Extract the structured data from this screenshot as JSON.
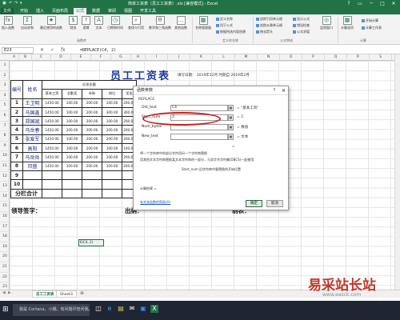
{
  "window": {
    "title": "简单工资表（员工工资表）.xls [兼容模式] - Excel",
    "quick_access": [
      "▣",
      "↶",
      "↷",
      "▾"
    ],
    "controls": [
      "?",
      "▭",
      "─",
      "□",
      "✕"
    ]
  },
  "tabs": [
    "文件",
    "开始",
    "插入",
    "页面布局",
    "公式",
    "数据",
    "审阅",
    "视图",
    "开发工具"
  ],
  "active_tab": "公式",
  "ribbon": {
    "big_buttons": [
      {
        "icon": "fx",
        "label": "插入函数"
      },
      {
        "icon": "Σ",
        "label": "自动求和"
      },
      {
        "icon": "★",
        "label": "最近使用的函数"
      },
      {
        "icon": "$",
        "label": "财务"
      },
      {
        "icon": "?",
        "label": "逻辑"
      },
      {
        "icon": "A",
        "label": "文本"
      },
      {
        "icon": "◷",
        "label": "日期和时间"
      },
      {
        "icon": "⌕",
        "label": "查找与引用"
      },
      {
        "icon": "θ",
        "label": "数学和三角函数"
      },
      {
        "icon": "…",
        "label": "其他函数"
      },
      {
        "icon": "▦",
        "label": "名称管理器"
      }
    ],
    "small": [
      [
        "定义名称",
        "用于公式",
        "根据所选内容创建"
      ],
      [
        "追踪引用单元格",
        "追踪从属单元格",
        "移去箭头"
      ],
      [
        "显示公式",
        "错误检查",
        "公式求值"
      ]
    ],
    "watch": "监视窗口",
    "calc": "计算选项",
    "calc_now": "开始计算",
    "calc_sheet": "计算工作表",
    "groups": [
      "函数库",
      "定义的名称",
      "公式审核",
      "计算"
    ]
  },
  "formula_bar": {
    "name_box": "E23",
    "buttons": [
      "✕",
      "✓",
      "fx"
    ],
    "formula": "=REPLACE(C4, 2)"
  },
  "columns": [
    "A",
    "B",
    "C",
    "D",
    "E",
    "F",
    "G",
    "H",
    "I",
    "J",
    "K",
    "L",
    "M",
    "N",
    "O",
    "P",
    "Q",
    "R",
    "S"
  ],
  "rows": [
    "1",
    "2",
    "3",
    "4",
    "5",
    "6",
    "7",
    "8",
    "9",
    "10",
    "11",
    "12",
    "13",
    "14",
    "15",
    "16",
    "17",
    "18",
    "19",
    "20",
    "21",
    "22",
    "23"
  ],
  "sheet": {
    "title": "员工工资表",
    "date_line": "填写日期： 2019年12月 时期自 2019年2月",
    "headers": {
      "num": "编号",
      "name": "姓名",
      "pay_group": "应发金额",
      "deduct_group": "应扣金额",
      "basic": "基本工资",
      "allowance": "全勤奖",
      "bonus": "补助",
      "post": "岗位",
      "reward": "奖金"
    },
    "employees": [
      {
        "num": "1",
        "name": "王卫明",
        "values": [
          "1450.00",
          "100.00",
          "200.00",
          "100.00",
          "200.00"
        ]
      },
      {
        "num": "2",
        "name": "马国鑫",
        "values": [
          "1450.00",
          "100.00",
          "200.00",
          "300.00",
          "300.00"
        ]
      },
      {
        "num": "3",
        "name": "郑国斌",
        "values": [
          "1450.00",
          "100.00",
          "200.00",
          "100.00",
          "200.00"
        ]
      },
      {
        "num": "4",
        "name": "马岳春",
        "values": [
          "1450.00",
          "100.00",
          "200.00",
          "100.00",
          "200.00"
        ]
      },
      {
        "num": "5",
        "name": "张爱军",
        "values": [
          "1450.00",
          "100.00",
          "200.00",
          "200.00",
          "200.00"
        ]
      },
      {
        "num": "6",
        "name": "高阳",
        "values": [
          "1450.00",
          "100.00",
          "200.00",
          "100.00",
          "100.00"
        ]
      },
      {
        "num": "7",
        "name": "马岳岳",
        "values": [
          "1450.00",
          "100.00",
          "200.00",
          "100.00",
          "200.00"
        ]
      },
      {
        "num": "8",
        "name": "邓盛",
        "values": [
          "1450.00",
          "100.00",
          "200.00",
          "100.00",
          "200.00"
        ]
      },
      {
        "num": "9",
        "name": "",
        "values": [
          "",
          "",
          "",
          "",
          ""
        ]
      },
      {
        "num": "10",
        "name": "",
        "values": [
          "",
          "",
          "",
          "",
          ""
        ]
      }
    ],
    "total_label": "分栏合计",
    "signatures": [
      "领导签字：",
      "出纳：",
      "制表："
    ],
    "active_cell_text": "E(C4, 2)"
  },
  "dialog": {
    "title": "函数参数",
    "help": "?",
    "close": "✕",
    "function_name": "REPLACE",
    "args": [
      {
        "label": "Old_text",
        "value": "C4",
        "result": "= \"基本工资\""
      },
      {
        "label": "Start_num",
        "value": "2",
        "result": "= 2"
      },
      {
        "label": "Num_bytes",
        "value": "",
        "result": "= 数值"
      },
      {
        "label": "New_text",
        "value": "",
        "result": "= 文本"
      }
    ],
    "extra_result": "=",
    "desc1": "将一个字符串中的部分字符用另一个字符串替换",
    "desc2": "用其他文本字符串替换某文本字符串的一部分，与双字节字符集(DBCS)一起使用",
    "desc3": "Start_num  旧字符串中要替换的开始位置",
    "calc_result": "计算结果 =",
    "help_link": "有关该函数的帮助(H)",
    "ok": "确定",
    "cancel": "取消"
  },
  "sheet_tabs": [
    "员工工资表",
    "Sheet3"
  ],
  "add_sheet": "⊕",
  "taskbar": {
    "start": "⊞",
    "search": "我是 Cortana，小娜。有问题尽管问我。",
    "icons": [
      "◫",
      "e",
      "▤",
      "✉",
      "▣",
      "X"
    ]
  },
  "watermark": {
    "text": "易采站长站",
    "url": "www.easck.com"
  }
}
